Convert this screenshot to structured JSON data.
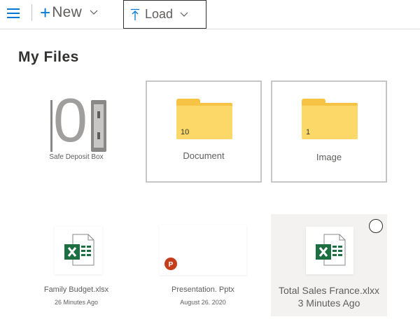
{
  "toolbar": {
    "new_label": "New",
    "load_label": "Load"
  },
  "page": {
    "title": "My Files"
  },
  "vault": {
    "count": "0",
    "label": "Safe Deposit Box"
  },
  "folders": [
    {
      "name": "Document",
      "count": "10"
    },
    {
      "name": "Image",
      "count": "1"
    }
  ],
  "files": [
    {
      "name": "Family Budget.xlsx",
      "modified": "26 Minutes Ago",
      "type": "excel"
    },
    {
      "name": "Presentation. Pptx",
      "modified": "August 26. 2020",
      "type": "powerpoint"
    },
    {
      "name": "Total Sales France.xlxx",
      "modified": "3 Minutes Ago",
      "type": "excel",
      "selected": true
    }
  ],
  "colors": {
    "accent": "#0078d4",
    "folder": "#fcd869",
    "excel": "#1d6f42",
    "powerpoint": "#c43e1c"
  }
}
